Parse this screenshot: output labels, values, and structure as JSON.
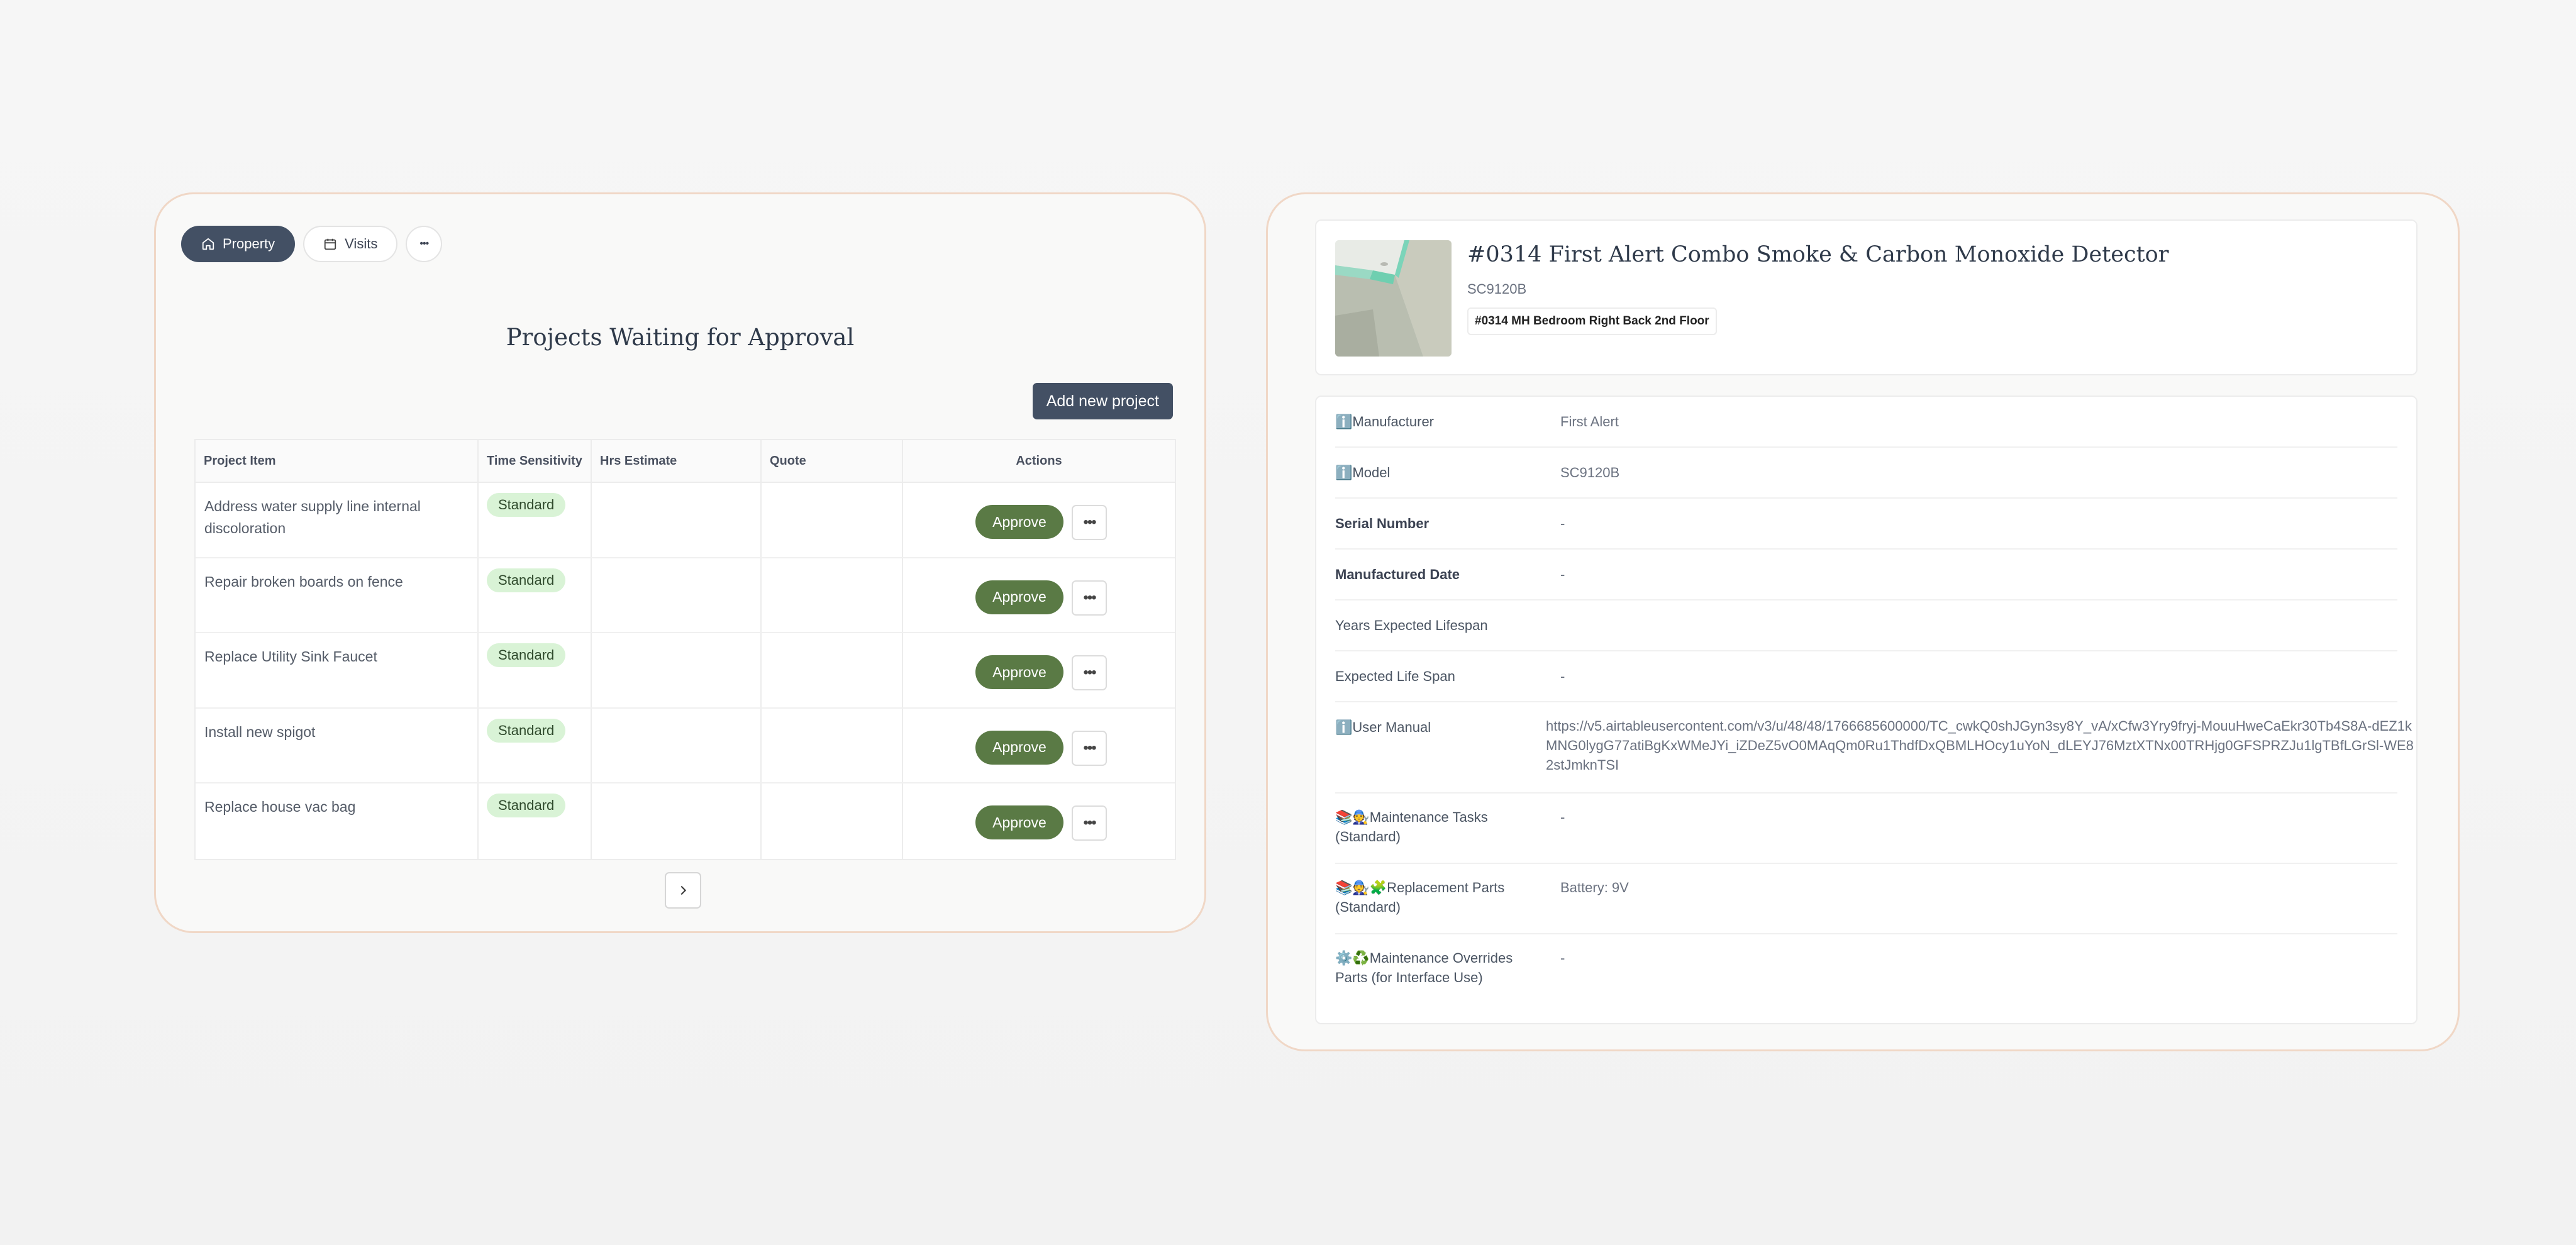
{
  "nav": {
    "property_label": "Property",
    "visits_label": "Visits",
    "more_label": "•••"
  },
  "projects": {
    "title": "Projects Waiting for Approval",
    "add_button": "Add new project",
    "columns": [
      "Project Item",
      "Time Sensitivity",
      "Hrs Estimate",
      "Quote",
      "Actions"
    ],
    "rows": [
      {
        "item": "Address water supply line internal discoloration",
        "sensitivity": "Standard",
        "hrs": "",
        "quote": "",
        "approve": "Approve",
        "more": "•••"
      },
      {
        "item": "Repair broken boards on fence",
        "sensitivity": "Standard",
        "hrs": "",
        "quote": "",
        "approve": "Approve",
        "more": "•••"
      },
      {
        "item": "Replace Utility Sink Faucet",
        "sensitivity": "Standard",
        "hrs": "",
        "quote": "",
        "approve": "Approve",
        "more": "•••"
      },
      {
        "item": "Install new spigot",
        "sensitivity": "Standard",
        "hrs": "",
        "quote": "",
        "approve": "Approve",
        "more": "•••"
      },
      {
        "item": "Replace house vac bag",
        "sensitivity": "Standard",
        "hrs": "",
        "quote": "",
        "approve": "Approve",
        "more": "•••"
      }
    ]
  },
  "device": {
    "title": "#0314 First Alert Combo Smoke & Carbon Monoxide Detector",
    "model_sub": "SC9120B",
    "location_tag": "#0314 MH Bedroom Right Back 2nd Floor",
    "fields": [
      {
        "label": "ℹ️Manufacturer",
        "value": "First Alert"
      },
      {
        "label": "ℹ️Model",
        "value": "SC9120B"
      },
      {
        "label": "Serial Number",
        "value": "-"
      },
      {
        "label": "Manufactured Date",
        "value": "-"
      },
      {
        "label": "Years Expected Lifespan",
        "value": ""
      },
      {
        "label": "Expected Life Span",
        "value": "-"
      },
      {
        "label": "ℹ️User Manual",
        "value": "https://v5.airtableusercontent.com/v3/u/48/48/1766685600000/TC_cwkQ0shJGyn3sy8Y_vA/xCfw3Yry9fryj-MouuHweCaEkr30Tb4S8A-dEZ1kMNG0lygG77atiBgKxWMeJYi_iZDeZ5vO0MAqQm0Ru1ThdfDxQBMLHOcy1uYoN_dLEYJ76MztXTNx00TRHjg0GFSPRZJu1lgTBfLGrSl-WE82stJmknTSI"
      },
      {
        "label": "📚🧑‍🔧Maintenance Tasks (Standard)",
        "value": "-"
      },
      {
        "label": "📚🧑‍🔧🧩Replacement Parts (Standard)",
        "value": "Battery: 9V"
      },
      {
        "label": "⚙️♻️Maintenance Overrides Parts (for Interface Use)",
        "value": "-"
      }
    ]
  }
}
